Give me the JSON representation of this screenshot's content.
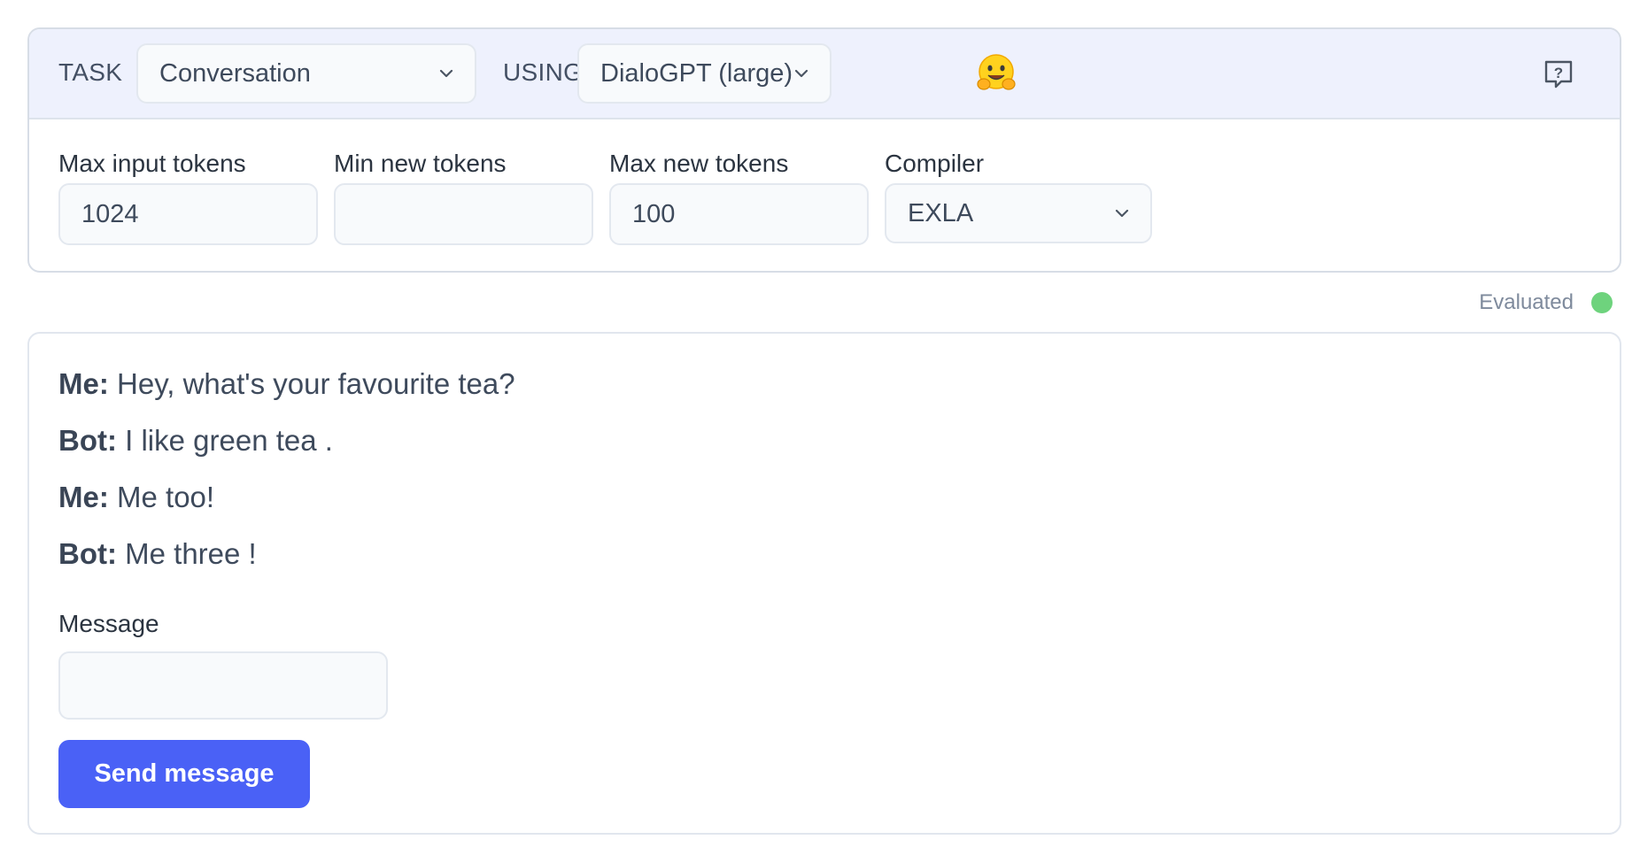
{
  "header": {
    "task_label": "TASK",
    "task_value": "Conversation",
    "using_label": "USING",
    "model_value": "DialoGPT (large)",
    "logo_icon": "hugging-face-emoji",
    "help_icon": "help-question-icon"
  },
  "settings": {
    "max_input_tokens": {
      "label": "Max input tokens",
      "value": "1024"
    },
    "min_new_tokens": {
      "label": "Min new tokens",
      "value": ""
    },
    "max_new_tokens": {
      "label": "Max new tokens",
      "value": "100"
    },
    "compiler": {
      "label": "Compiler",
      "value": "EXLA"
    }
  },
  "status": {
    "text": "Evaluated",
    "color": "#6ed37d"
  },
  "chat": {
    "messages": [
      {
        "speaker": "Me:",
        "text": "Hey, what's your favourite tea?"
      },
      {
        "speaker": "Bot:",
        "text": "I like green tea ."
      },
      {
        "speaker": "Me:",
        "text": "Me too!"
      },
      {
        "speaker": "Bot:",
        "text": "Me three !"
      }
    ],
    "message_label": "Message",
    "message_value": "",
    "send_label": "Send message"
  },
  "colors": {
    "accent": "#4a61f6",
    "header_bg": "#eef1fd",
    "status_ok": "#6ed37d"
  }
}
